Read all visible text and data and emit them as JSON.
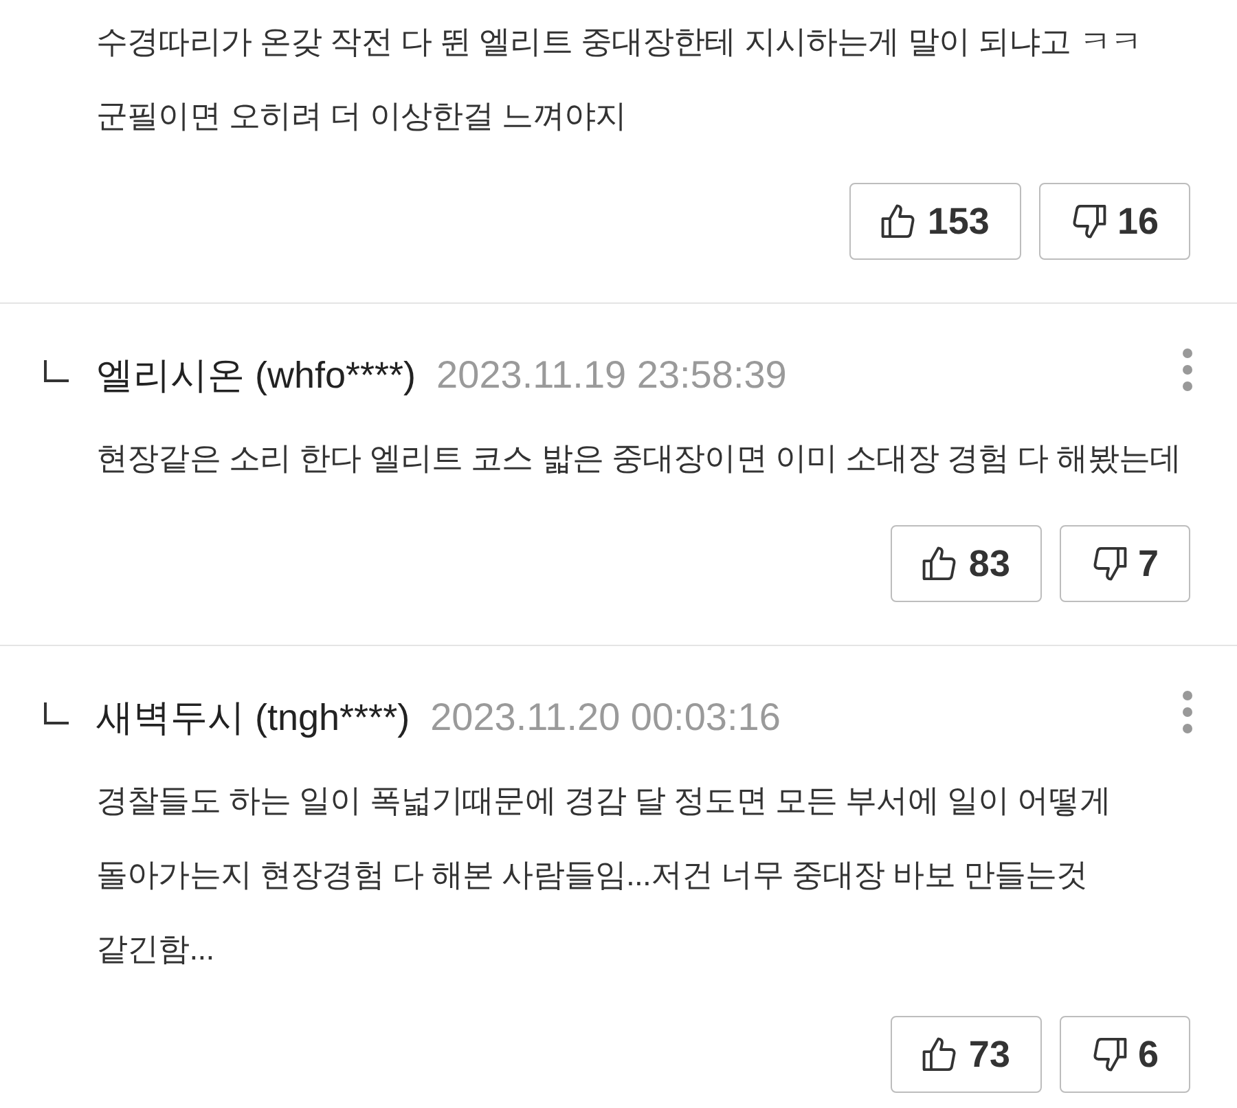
{
  "comments": [
    {
      "body": "수경따리가 온갖 작전 다 뛴 엘리트 중대장한테 지시하는게 말이 되냐고 ㅋㅋ 군필이면 오히려 더 이상한걸 느껴야지",
      "votes": [
        {
          "kind": "like",
          "count": "153"
        },
        {
          "kind": "dislike",
          "count": "16"
        }
      ]
    },
    {
      "header": {
        "reply": true,
        "author": "엘리시온 (whfo****)",
        "time": "2023.11.19 23:58:39"
      },
      "body": "현장같은 소리 한다 엘리트 코스 밟은 중대장이면 이미 소대장 경험 다 해봤는데",
      "votes": [
        {
          "kind": "like",
          "count": "83"
        },
        {
          "kind": "dislike",
          "count": "7"
        }
      ]
    },
    {
      "header": {
        "reply": true,
        "author": "새벽두시 (tngh****)",
        "time": "2023.11.20 00:03:16"
      },
      "body": "경찰들도 하는 일이 폭넓기때문에 경감 달 정도면 모든 부서에 일이 어떻게 돌아가는지 현장경험 다 해본 사람들임...저건 너무 중대장 바보 만들는것 같긴함...",
      "votes": [
        {
          "kind": "like",
          "count": "73"
        },
        {
          "kind": "dislike",
          "count": "6"
        }
      ]
    }
  ]
}
